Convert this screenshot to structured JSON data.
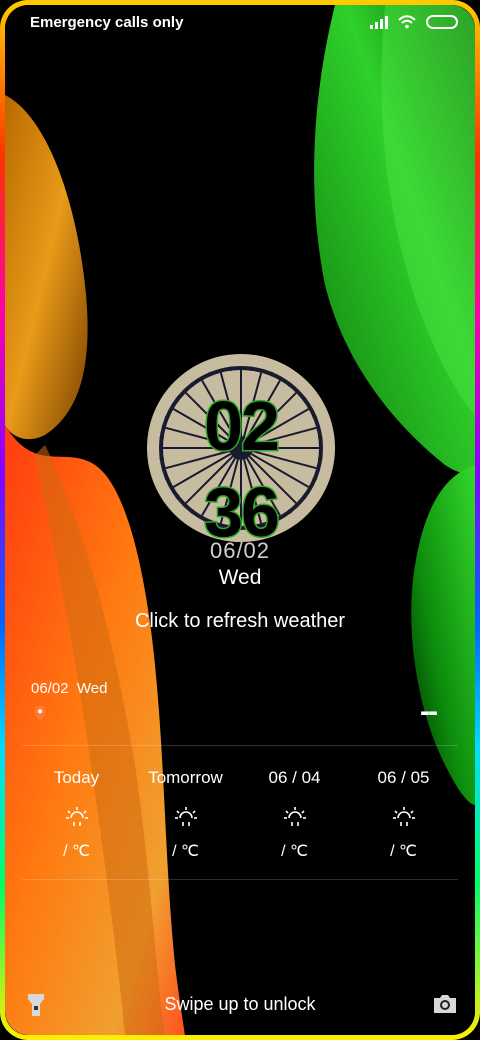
{
  "status_bar": {
    "carrier_text": "Emergency calls only",
    "icons": [
      "signal-icon",
      "wifi-icon",
      "battery-icon"
    ]
  },
  "clock": {
    "hour": "02",
    "minute": "36",
    "date": "06/02",
    "day": "Wed"
  },
  "weather": {
    "refresh_label": "Click to refresh weather",
    "date": "06/02",
    "day": "Wed",
    "current_temp": "--",
    "forecast": [
      {
        "day": "Today",
        "icon": "sun-cloud-icon",
        "temp": "/ ℃"
      },
      {
        "day": "Tomorrow",
        "icon": "sun-cloud-icon",
        "temp": "/ ℃"
      },
      {
        "day": "06 / 04",
        "icon": "sun-cloud-icon",
        "temp": "/ ℃"
      },
      {
        "day": "06 / 05",
        "icon": "sun-cloud-icon",
        "temp": "/ ℃"
      }
    ]
  },
  "bottom": {
    "swipe_label": "Swipe up to unlock",
    "left_icon": "flashlight-icon",
    "right_icon": "camera-icon"
  },
  "colors": {
    "saffron": "#ff8c00",
    "green": "#22c322",
    "chakra_bg": "#c8bca0",
    "chakra_navy": "#1a1a2e"
  }
}
